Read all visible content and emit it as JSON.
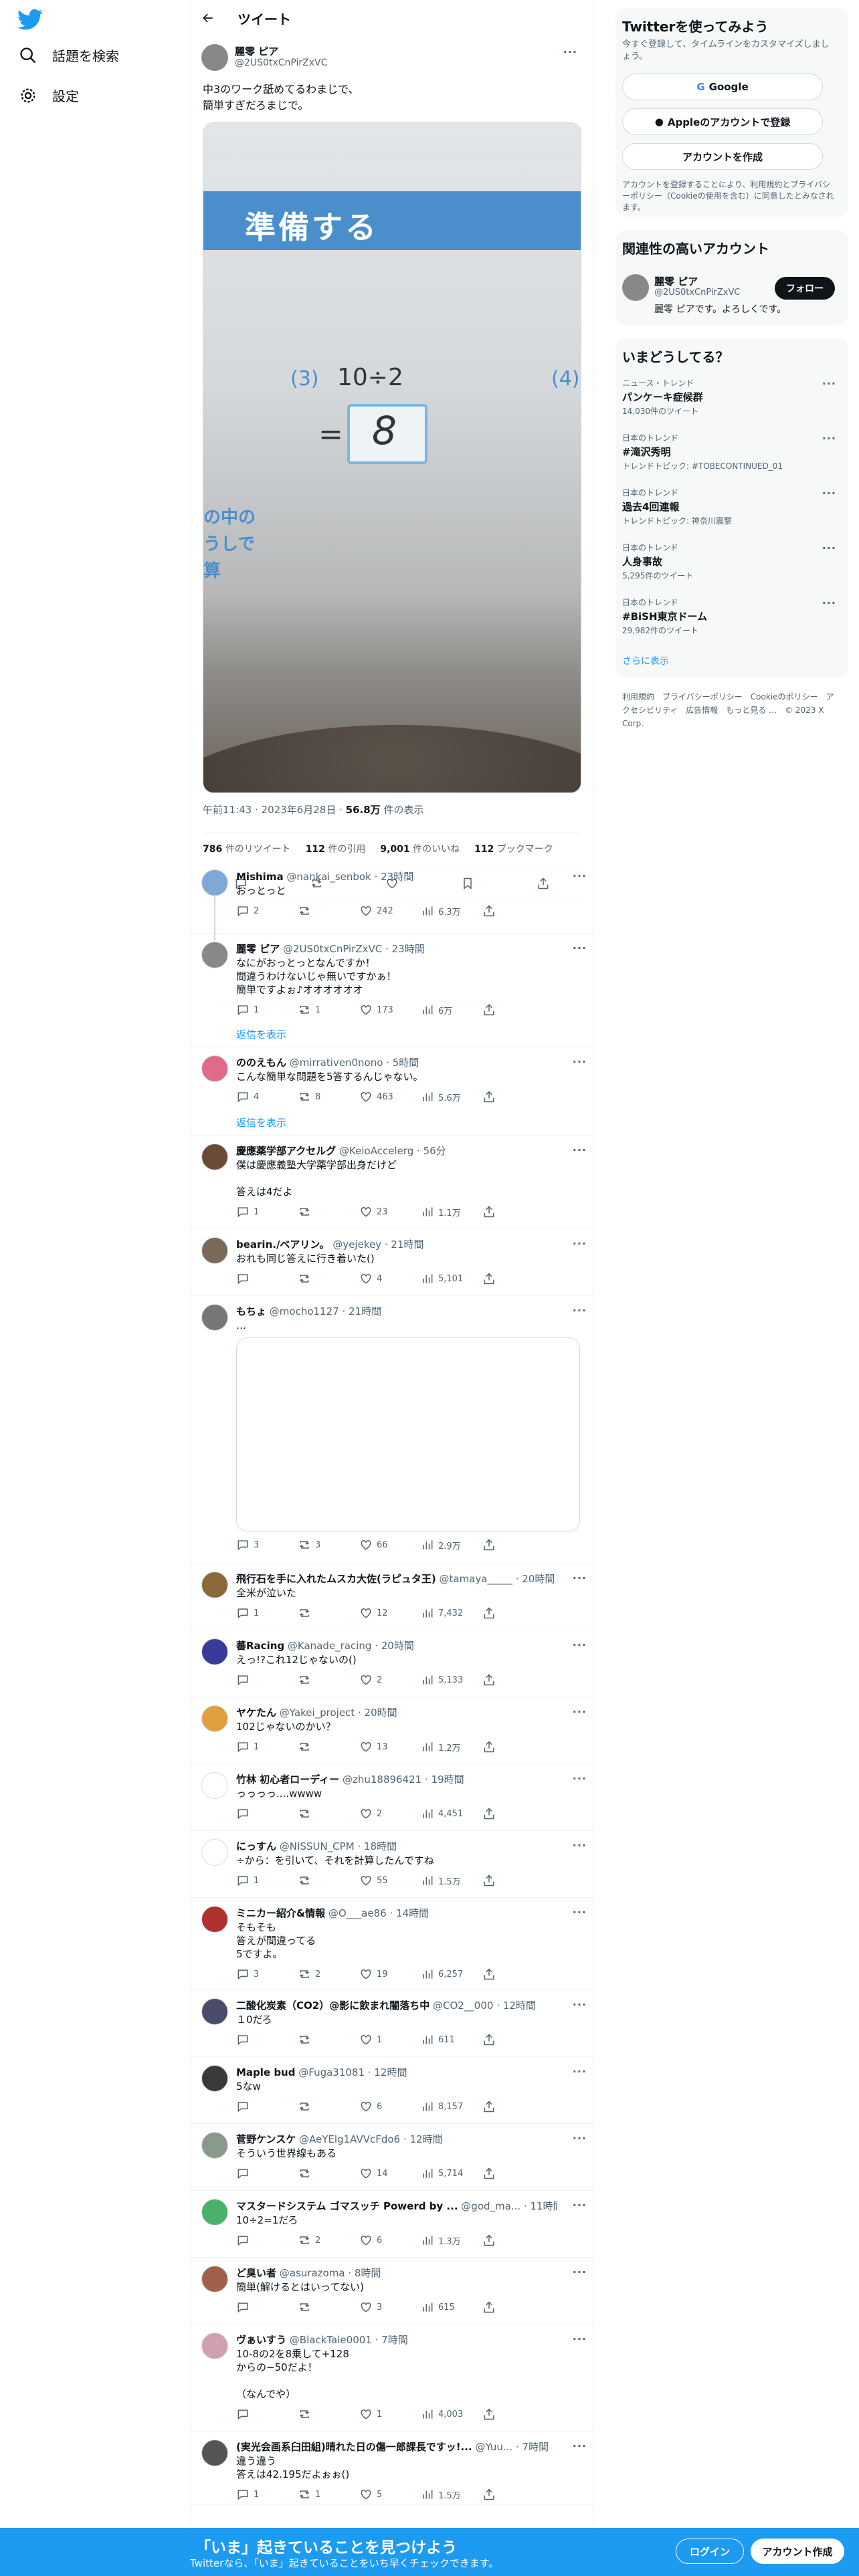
{
  "nav": {
    "search_label": "話題を検索",
    "settings_label": "設定"
  },
  "header": {
    "title": "ツイート"
  },
  "tweet": {
    "author_name": "麗零 ピア",
    "author_handle": "@2US0txCnPirZxVC",
    "text": "中3のワーク舐めてるわまじで、\n簡単すぎだろまじで。",
    "photo_text": {
      "band": "準備する",
      "q_num": "(3)",
      "expression": "10÷2",
      "equals": "=",
      "answer": "8",
      "q_next": "(4)",
      "side_text": "の中の\nうしで\n算"
    },
    "time": "午前11:43",
    "date": "2023年6月28日",
    "views": "56.8万",
    "views_label": "件の表示",
    "retweets": "786",
    "retweets_label": "件のリツイート",
    "quotes": "112",
    "quotes_label": "件の引用",
    "likes": "9,001",
    "likes_label": "件のいいね",
    "bookmarks": "112",
    "bookmarks_label": "ブックマーク"
  },
  "replies": [
    {
      "name": "Mishima",
      "handle": "@nankai_senbok",
      "time": "23時間",
      "text": "おっとっと",
      "reply": "2",
      "rt": "",
      "like": "242",
      "view": "6.3万"
    },
    {
      "name": "麗零 ピア",
      "handle": "@2US0txCnPirZxVC",
      "time": "23時間",
      "text": "なにがおっとっとなんですか！\n間違うわけないじゃ無いですかぁ！\n簡単ですよぉ♪オオオオオオ",
      "reply": "1",
      "rt": "1",
      "like": "173",
      "view": "6万"
    },
    {
      "name": "ののえもん",
      "handle": "@mirrativen0nono",
      "time": "5時間",
      "text": "こんな簡単な問題を5答するんじゃない。",
      "reply": "4",
      "rt": "8",
      "like": "463",
      "view": "5.6万"
    },
    {
      "name": "慶應薬学部アクセルグ",
      "handle": "@KeioAccelerg",
      "time": "56分",
      "text": "僕は慶應義塾大学薬学部出身だけど\n\n答えは4だよ",
      "reply": "1",
      "rt": "",
      "like": "23",
      "view": "1.1万"
    },
    {
      "name": "bearin./ベアリン。",
      "handle": "@yejekey",
      "time": "21時間",
      "text": "おれも同じ答えに行き着いた()",
      "reply": "",
      "rt": "",
      "like": "4",
      "view": "5,101"
    },
    {
      "name": "もちょ",
      "handle": "@mocho1127",
      "time": "21時間",
      "text": "…",
      "reply": "3",
      "rt": "3",
      "like": "66",
      "view": "2.9万"
    },
    {
      "name": "飛行石を手に入れたムスカ大佐(ラピュタ王)",
      "handle": "@tamaya_____",
      "time": "20時間",
      "text": "全米が泣いた",
      "reply": "1",
      "rt": "",
      "like": "12",
      "view": "7,432"
    },
    {
      "name": "蕃Racing",
      "handle": "@Kanade_racing",
      "time": "20時間",
      "text": "えっ!?これ12じゃないの()",
      "reply": "",
      "rt": "",
      "like": "2",
      "view": "5,133"
    },
    {
      "name": "ヤケたん",
      "handle": "@Yakei_project",
      "time": "20時間",
      "text": "102じゃないのかい？",
      "reply": "1",
      "rt": "",
      "like": "13",
      "view": "1.2万"
    },
    {
      "name": "竹林 初心者ローディー",
      "handle": "@zhu18896421",
      "time": "19時間",
      "text": "っっっっ....wwww",
      "reply": "",
      "rt": "",
      "like": "2",
      "view": "4,451"
    },
    {
      "name": "にっすん",
      "handle": "@NISSUN_CPM",
      "time": "18時間",
      "text": "÷から：を引いて、それを計算したんですね",
      "reply": "1",
      "rt": "",
      "like": "55",
      "view": "1.5万"
    },
    {
      "name": "ミニカー紹介&情報",
      "handle": "@O___ae86",
      "time": "14時間",
      "text": "そもそも\n答えが間違ってる\n5ですよ。",
      "reply": "3",
      "rt": "2",
      "like": "19",
      "view": "6,257"
    },
    {
      "name": "二酸化炭素（CO2）@影に飲まれ闇落ち中",
      "handle": "@CO2__000",
      "time": "12時間",
      "text": "１0だろ",
      "reply": "",
      "rt": "",
      "like": "1",
      "view": "611"
    },
    {
      "name": "Maple bud",
      "handle": "@Fuga31081",
      "time": "12時間",
      "text": "5なw",
      "reply": "",
      "rt": "",
      "like": "6",
      "view": "8,157"
    },
    {
      "name": "菅野ケンスケ",
      "handle": "@AeYElg1AVVcFdo6",
      "time": "12時間",
      "text": "そういう世界線もある",
      "reply": "",
      "rt": "",
      "like": "14",
      "view": "5,714"
    },
    {
      "name": "マスタードシステム ゴマスッチ Powerd by ...",
      "handle": "@god_ma...",
      "time": "11時間",
      "text": "10÷2=1だろ",
      "reply": "",
      "rt": "2",
      "like": "6",
      "view": "1.3万"
    },
    {
      "name": "ど臭い者",
      "handle": "@asurazoma",
      "time": "8時間",
      "text": "簡単(解けるとはいってない)",
      "reply": "",
      "rt": "",
      "like": "3",
      "view": "615"
    },
    {
      "name": "ヴぁいすう",
      "handle": "@BlackTale0001",
      "time": "7時間",
      "text": "10-8の2を8乗して+128\nからの−50だよ！\n\n（なんでや）",
      "reply": "",
      "rt": "",
      "like": "1",
      "view": "4,003"
    },
    {
      "name": "(実光会画系臼田組)晴れた日の傷一郎課長ですッ!...",
      "handle": "@Yuu...",
      "time": "7時間",
      "text": "違う違う\n答えは42.195だよぉぉ()",
      "reply": "1",
      "rt": "1",
      "like": "5",
      "view": "1.5万"
    }
  ],
  "show_replies_label": "返信を表示",
  "sidebar": {
    "signup_title": "Twitterを使ってみよう",
    "signup_sub": "今すぐ登録して、タイムラインをカスタマイズしましょう。",
    "google_label": "Google",
    "apple_label": "Appleのアカウントで登録",
    "create_label": "アカウントを作成",
    "terms": "アカウントを登録することにより、利用規約とプライバシーポリシー（Cookieの使用を含む）に同意したとみなされます。",
    "related_title": "関連性の高いアカウント",
    "related_name": "麗零 ピア",
    "related_handle": "@2US0txCnPirZxVC",
    "related_bio": "麗零 ピアです。よろしくです。",
    "follow_label": "フォロー",
    "trends_title": "いまどうしてる？",
    "trends": [
      {
        "cat": "ニュース・トレンド",
        "name": "パンケーキ症候群",
        "sub": "14,030件のツイート"
      },
      {
        "cat": "日本のトレンド",
        "name": "#滝沢秀明",
        "sub": "トレンドトピック: #TOBECONTINUED_01"
      },
      {
        "cat": "日本のトレンド",
        "name": "過去4回連報",
        "sub": "トレンドトピック: 神奈川震撃"
      },
      {
        "cat": "日本のトレンド",
        "name": "人身事故",
        "sub": "5,295件のツイート"
      },
      {
        "cat": "日本のトレンド",
        "name": "#BiSH東京ドーム",
        "sub": "29,982件のツイート"
      }
    ],
    "show_more": "さらに表示",
    "footer": "利用規約　プライバシーポリシー　Cookieのポリシー　アクセシビリティ　広告情報　もっと見る …　© 2023 X Corp."
  },
  "bottom": {
    "title": "「いま」起きていることを見つけよう",
    "sub": "Twitterなら、「いま」起きていることをいち早くチェックできます。",
    "login": "ログイン",
    "signup": "アカウント作成"
  },
  "colors": {
    "accent": "#1d9bf0",
    "text": "#0f1419",
    "muted": "#536471"
  }
}
